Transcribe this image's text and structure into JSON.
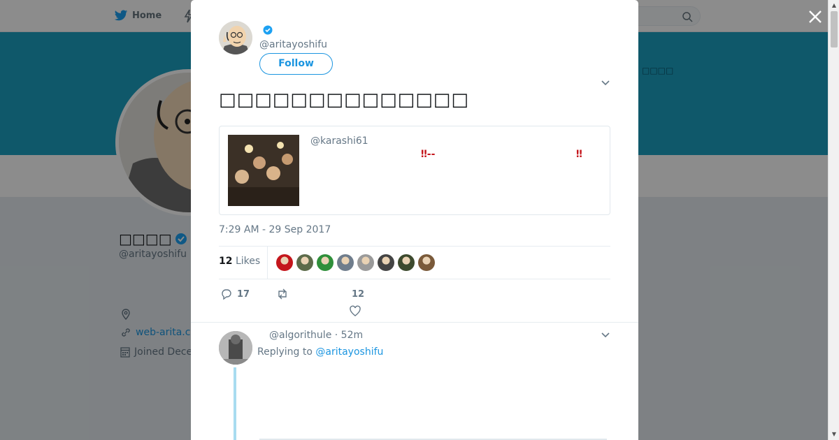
{
  "background": {
    "nav": {
      "home_label": "Home"
    },
    "banner_text": "□□□□",
    "profile": {
      "name": "□□□□",
      "handle": "@aritayoshifu",
      "link": "web-arita.co",
      "joined": "Joined Dece"
    }
  },
  "tweet": {
    "author_handle": "@aritayoshifu",
    "follow_label": "Follow",
    "text": "□□□□□□□□□□□□□□",
    "quote": {
      "handle": "@karashi61",
      "text": "‼--",
      "trailing": "‼"
    },
    "timestamp": "7:29 AM - 29 Sep 2017",
    "likes_count": "12",
    "likes_label": "Likes",
    "likers": [
      "#c4161c",
      "#5c6b4a",
      "#2f8f3a",
      "#6f7d8c",
      "#9a9a9a",
      "#444444",
      "#3d4a2e",
      "#7a5a3a"
    ],
    "actions": {
      "replies": "17",
      "retweets": "",
      "likes": "12"
    }
  },
  "reply": {
    "handle": "@algorithule",
    "time": "52m",
    "replying_to_label": "Replying to",
    "replying_to_handle": "@aritayoshifu"
  },
  "colors": {
    "accent": "#1b95e0",
    "banner": "#1da0c1",
    "alert": "#c4151c"
  }
}
